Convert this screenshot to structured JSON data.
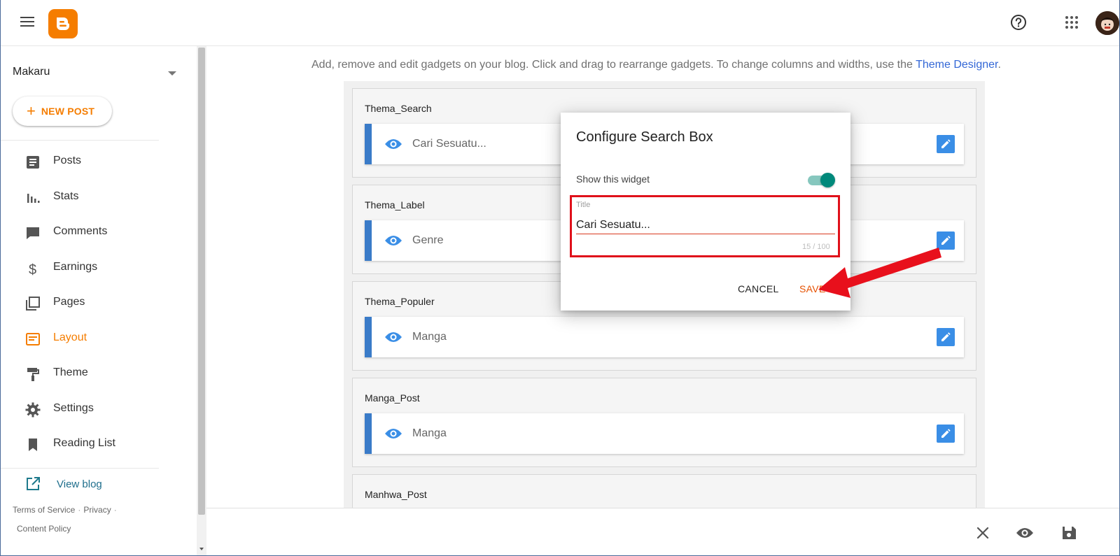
{
  "header": {
    "menu_icon": "hamburger-icon",
    "logo_icon": "blogger-logo",
    "help_icon": "help-circle-icon",
    "apps_icon": "apps-grid-icon"
  },
  "sidebar": {
    "blog_name": "Makaru",
    "new_post_label": "NEW POST",
    "nav": [
      {
        "label": "Posts",
        "icon": "posts-icon"
      },
      {
        "label": "Stats",
        "icon": "stats-icon"
      },
      {
        "label": "Comments",
        "icon": "comments-icon"
      },
      {
        "label": "Earnings",
        "icon": "dollar-icon"
      },
      {
        "label": "Pages",
        "icon": "pages-icon"
      },
      {
        "label": "Layout",
        "icon": "layout-icon",
        "active": true
      },
      {
        "label": "Theme",
        "icon": "paint-roller-icon"
      },
      {
        "label": "Settings",
        "icon": "gear-icon"
      },
      {
        "label": "Reading List",
        "icon": "bookmark-icon"
      }
    ],
    "view_blog_label": "View blog",
    "footer": {
      "terms": "Terms of Service",
      "privacy": "Privacy",
      "content_policy": "Content Policy"
    }
  },
  "main": {
    "instructions": "Add, remove and edit gadgets on your blog. Click and drag to rearrange gadgets. To change columns and widths, use the",
    "theme_designer_link": "Theme Designer",
    "instructions_end": ".",
    "sections": [
      {
        "title": "Thema_Search",
        "gadget": "Cari Sesuatu..."
      },
      {
        "title": "Thema_Label",
        "gadget": "Genre"
      },
      {
        "title": "Thema_Populer",
        "gadget": "Manga"
      },
      {
        "title": "Manga_Post",
        "gadget": "Manga"
      },
      {
        "title": "Manhwa_Post",
        "gadget": ""
      }
    ]
  },
  "dialog": {
    "title": "Configure Search Box",
    "show_widget_label": "Show this widget",
    "show_widget_on": true,
    "title_field_label": "Title",
    "title_field_value": "Cari Sesuatu...",
    "title_char_count": "15 / 100",
    "cancel_label": "CANCEL",
    "save_label": "SAVE"
  },
  "bottom_toolbar": {
    "close_icon": "close-icon",
    "preview_icon": "eye-icon",
    "save_icon": "floppy-save-icon"
  },
  "colors": {
    "brand_orange": "#f57d00",
    "gadget_bar": "#3a7bc8",
    "edit_button": "#3a8ee6",
    "toggle_on": "#00897b",
    "highlight_red": "#e0101a",
    "save_text": "#e65100",
    "link_blue": "#3367d6"
  }
}
